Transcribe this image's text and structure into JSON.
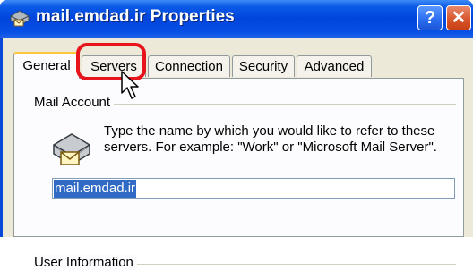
{
  "window": {
    "title": "mail.emdad.ir Properties",
    "help_label": "?",
    "close_label": "✕"
  },
  "tabs": [
    {
      "label": "General",
      "active": true
    },
    {
      "label": "Servers",
      "active": false,
      "highlighted": true
    },
    {
      "label": "Connection",
      "active": false
    },
    {
      "label": "Security",
      "active": false
    },
    {
      "label": "Advanced",
      "active": false
    }
  ],
  "mail_account": {
    "group_label": "Mail Account",
    "description": "Type the name by which you would like to refer to these servers.  For example: \"Work\" or \"Microsoft Mail Server\".",
    "account_name_value": "mail.emdad.ir"
  },
  "user_information": {
    "group_label": "User Information"
  },
  "icons": {
    "title_icon": "mail-account-icon",
    "server_icon": "mail-server-icon",
    "cursor": "mouse-pointer-icon"
  },
  "colors": {
    "titlebar": "#0044dc",
    "highlight_ring": "#e8141c",
    "selection": "#316ac5",
    "active_tab_accent": "#ffc73c"
  }
}
